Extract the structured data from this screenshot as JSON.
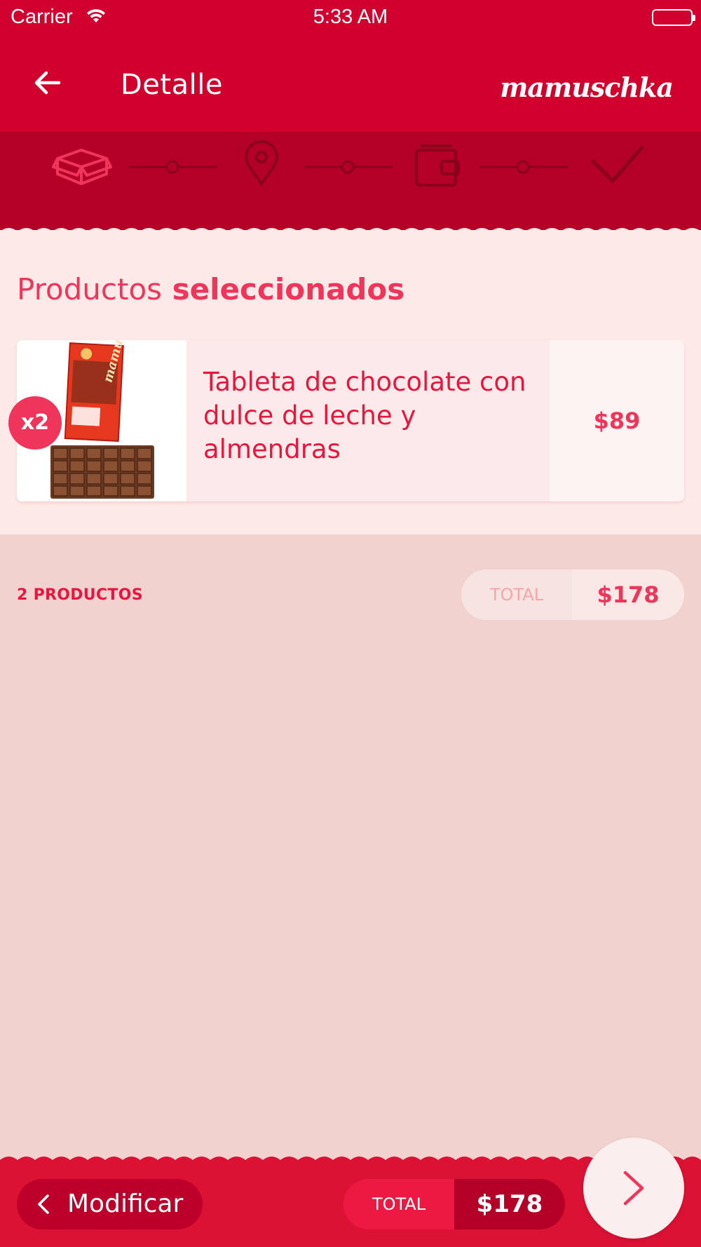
{
  "status_bar": {
    "carrier": "Carrier",
    "time": "5:33 AM"
  },
  "nav": {
    "title": "Detalle",
    "logo": "mamuschka",
    "back_icon": "arrow-left-icon"
  },
  "stepper": {
    "steps": [
      {
        "icon": "box-icon",
        "active": true
      },
      {
        "icon": "location-pin-icon",
        "active": false
      },
      {
        "icon": "wallet-icon",
        "active": false
      },
      {
        "icon": "checkmark-icon",
        "active": false
      }
    ]
  },
  "section": {
    "title_light": "Productos",
    "title_bold": "seleccionados"
  },
  "products": [
    {
      "name": "Tableta de chocolate con dulce de leche y almendras",
      "price": "$89",
      "quantity": "x2",
      "image_brand": "mamuschka"
    }
  ],
  "summary": {
    "count": "2 PRODUCTOS",
    "total_label": "TOTAL",
    "total_value": "$178"
  },
  "footer": {
    "modify_label": "Modificar",
    "total_label": "TOTAL",
    "total_value": "$178",
    "next_icon": "chevron-right-icon"
  },
  "colors": {
    "primary": "#d2002d",
    "dark": "#b40026",
    "accent": "#f0355b",
    "light_bg": "#fdeae8",
    "page_bg": "#f2d2cf"
  }
}
